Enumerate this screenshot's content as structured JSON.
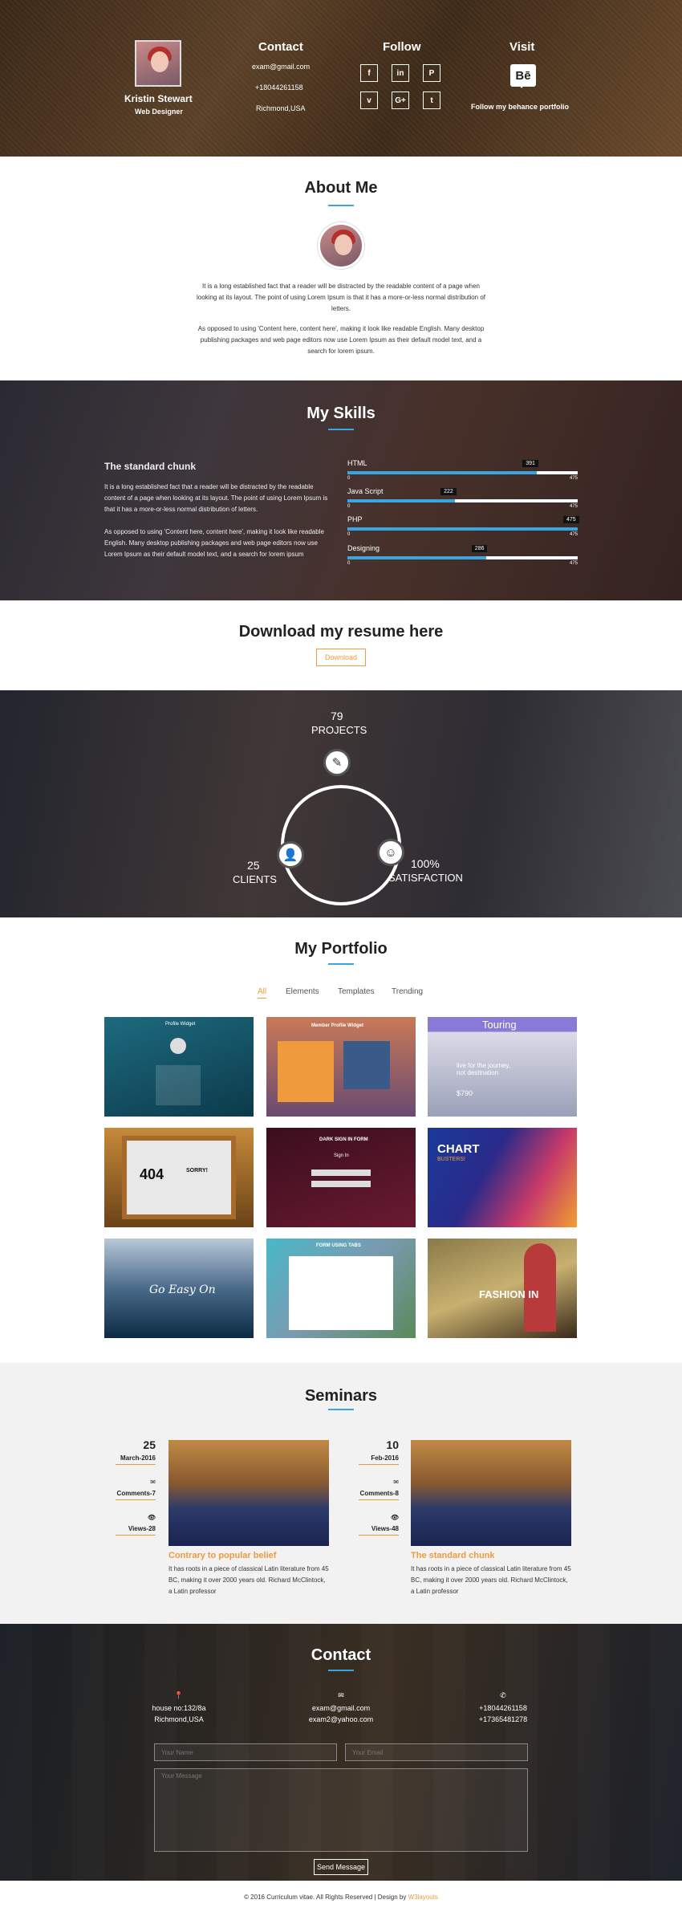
{
  "header": {
    "name": "Kristin Stewart",
    "role": "Web Designer",
    "contact_title": "Contact",
    "email": "exam@gmail.com",
    "phone": "+18044261158",
    "location": "Richmond,USA",
    "follow_title": "Follow",
    "social": [
      {
        "icon": "facebook-icon",
        "glyph": "f"
      },
      {
        "icon": "linkedin-icon",
        "glyph": "in"
      },
      {
        "icon": "pinterest-icon",
        "glyph": "P"
      },
      {
        "icon": "vimeo-icon",
        "glyph": "v"
      },
      {
        "icon": "google-plus-icon",
        "glyph": "G+"
      },
      {
        "icon": "tumblr-icon",
        "glyph": "t"
      }
    ],
    "visit_title": "Visit",
    "behance_glyph": "Bē",
    "behance_text": "Follow my behance portfolio"
  },
  "about": {
    "title": "About Me",
    "p1": "It is a long established fact that a reader will be distracted by the readable content of a page when looking at its layout. The point of using Lorem Ipsum is that it has a more-or-less normal distribution of letters.",
    "p2": "As opposed to using 'Content here, content here', making it look like readable English. Many desktop publishing packages and web page editors now use Lorem Ipsum as their default model text, and a search for lorem ipsum."
  },
  "skills": {
    "title": "My Skills",
    "heading": "The standard chunk",
    "p1": "It is a long established fact that a reader will be distracted by the readable content of a page when looking at its layout. The point of using Lorem Ipsum is that it has a more-or-less normal distribution of letters.",
    "p2": "As opposed to using 'Content here, content here', making it look like readable English. Many desktop publishing packages and web page editors now use Lorem Ipsum as their default model text, and a search for lorem ipsum",
    "min_label": "0",
    "max_label": "475",
    "bars": [
      {
        "label": "HTML",
        "value": 391,
        "tag": "391"
      },
      {
        "label": "Java Script",
        "value": 222,
        "tag": "222"
      },
      {
        "label": "PHP",
        "value": 475,
        "tag": "475"
      },
      {
        "label": "Designing",
        "value": 286,
        "tag": "286"
      }
    ],
    "accent": "#3aa6e0"
  },
  "resume": {
    "title": "Download my resume here",
    "button": "Download"
  },
  "stats": {
    "projects_num": "79",
    "projects_label": "PROJECTS",
    "clients_num": "25",
    "clients_label": "CLIENTS",
    "satisfaction_num": "100%",
    "satisfaction_label": "SATISFACTION"
  },
  "portfolio": {
    "title": "My Portfolio",
    "filters": [
      "All",
      "Elements",
      "Templates",
      "Trending"
    ],
    "active_filter": "All",
    "tiles": [
      {
        "label": "Profile Widget"
      },
      {
        "label": "Member Profile Widget"
      },
      {
        "label": "Touring",
        "sub": "live for the journey, not destination",
        "price": "$790"
      },
      {
        "label": "404",
        "sub": "SORRY!"
      },
      {
        "label": "DARK SIGN IN FORM",
        "sub": "Sign In"
      },
      {
        "label": "CHART",
        "sub": "BUSTERS!"
      },
      {
        "label": "Go Easy On"
      },
      {
        "label": "FORM USING TABS"
      },
      {
        "label": "FASHION IN"
      }
    ]
  },
  "seminars": {
    "title": "Seminars",
    "events": [
      {
        "day": "25",
        "month": "March-2016",
        "comments": "Comments-7",
        "views": "Views-28",
        "title": "Contrary to popular belief",
        "text": "It has roots in a piece of classical Latin literature from 45 BC, making it over 2000 years old. Richard McClintock, a Latin professor"
      },
      {
        "day": "10",
        "month": "Feb-2016",
        "comments": "Comments-8",
        "views": "Views-48",
        "title": "The standard chunk",
        "text": "It has roots in a piece of classical Latin literature from 45 BC, making it over 2000 years old. Richard McClintock, a Latin professor"
      }
    ]
  },
  "contact": {
    "title": "Contact",
    "address1": "house no:132/8a",
    "address2": "Richmond,USA",
    "email1": "exam@gmail.com",
    "email2": "exam2@yahoo.com",
    "phone1": "+18044261158",
    "phone2": "+17365481278",
    "name_placeholder": "Your Name",
    "email_placeholder": "Your Email",
    "message_placeholder": "Your Message",
    "send": "Send Message"
  },
  "footer": {
    "text": "© 2016 Curriculum vitae. All Rights Reserved | Design by",
    "brand": "W3layouts",
    "brand_color": "#f09a3e"
  }
}
